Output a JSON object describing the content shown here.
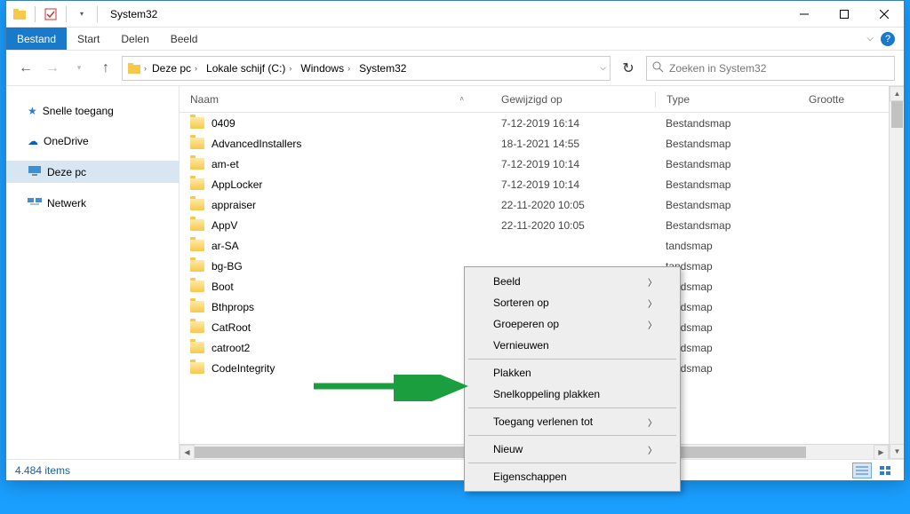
{
  "window": {
    "title": "System32"
  },
  "ribbon": {
    "file": "Bestand",
    "tabs": [
      "Start",
      "Delen",
      "Beeld"
    ]
  },
  "nav": {
    "breadcrumb": [
      "Deze pc",
      "Lokale schijf (C:)",
      "Windows",
      "System32"
    ],
    "search_placeholder": "Zoeken in System32"
  },
  "sidebar": {
    "items": [
      {
        "label": "Snelle toegang",
        "icon": "star"
      },
      {
        "label": "OneDrive",
        "icon": "cloud"
      },
      {
        "label": "Deze pc",
        "icon": "pc",
        "selected": true
      },
      {
        "label": "Netwerk",
        "icon": "network"
      }
    ]
  },
  "columns": {
    "name": "Naam",
    "date": "Gewijzigd op",
    "type": "Type",
    "size": "Grootte"
  },
  "rows": [
    {
      "name": "0409",
      "date": "7-12-2019 16:14",
      "type": "Bestandsmap"
    },
    {
      "name": "AdvancedInstallers",
      "date": "18-1-2021 14:55",
      "type": "Bestandsmap"
    },
    {
      "name": "am-et",
      "date": "7-12-2019 10:14",
      "type": "Bestandsmap"
    },
    {
      "name": "AppLocker",
      "date": "7-12-2019 10:14",
      "type": "Bestandsmap"
    },
    {
      "name": "appraiser",
      "date": "22-11-2020 10:05",
      "type": "Bestandsmap"
    },
    {
      "name": "AppV",
      "date": "22-11-2020 10:05",
      "type": "Bestandsmap"
    },
    {
      "name": "ar-SA",
      "date": "",
      "type": "tandsmap"
    },
    {
      "name": "bg-BG",
      "date": "",
      "type": "tandsmap"
    },
    {
      "name": "Boot",
      "date": "",
      "type": "tandsmap"
    },
    {
      "name": "Bthprops",
      "date": "",
      "type": "tandsmap"
    },
    {
      "name": "CatRoot",
      "date": "",
      "type": "tandsmap"
    },
    {
      "name": "catroot2",
      "date": "",
      "type": "tandsmap"
    },
    {
      "name": "CodeIntegrity",
      "date": "",
      "type": "tandsmap"
    }
  ],
  "context_menu": {
    "groups": [
      [
        {
          "label": "Beeld",
          "submenu": true
        },
        {
          "label": "Sorteren op",
          "submenu": true
        },
        {
          "label": "Groeperen op",
          "submenu": true
        },
        {
          "label": "Vernieuwen"
        }
      ],
      [
        {
          "label": "Plakken"
        },
        {
          "label": "Snelkoppeling plakken"
        }
      ],
      [
        {
          "label": "Toegang verlenen tot",
          "submenu": true
        }
      ],
      [
        {
          "label": "Nieuw",
          "submenu": true
        }
      ],
      [
        {
          "label": "Eigenschappen"
        }
      ]
    ]
  },
  "status": {
    "count": "4.484 items"
  }
}
